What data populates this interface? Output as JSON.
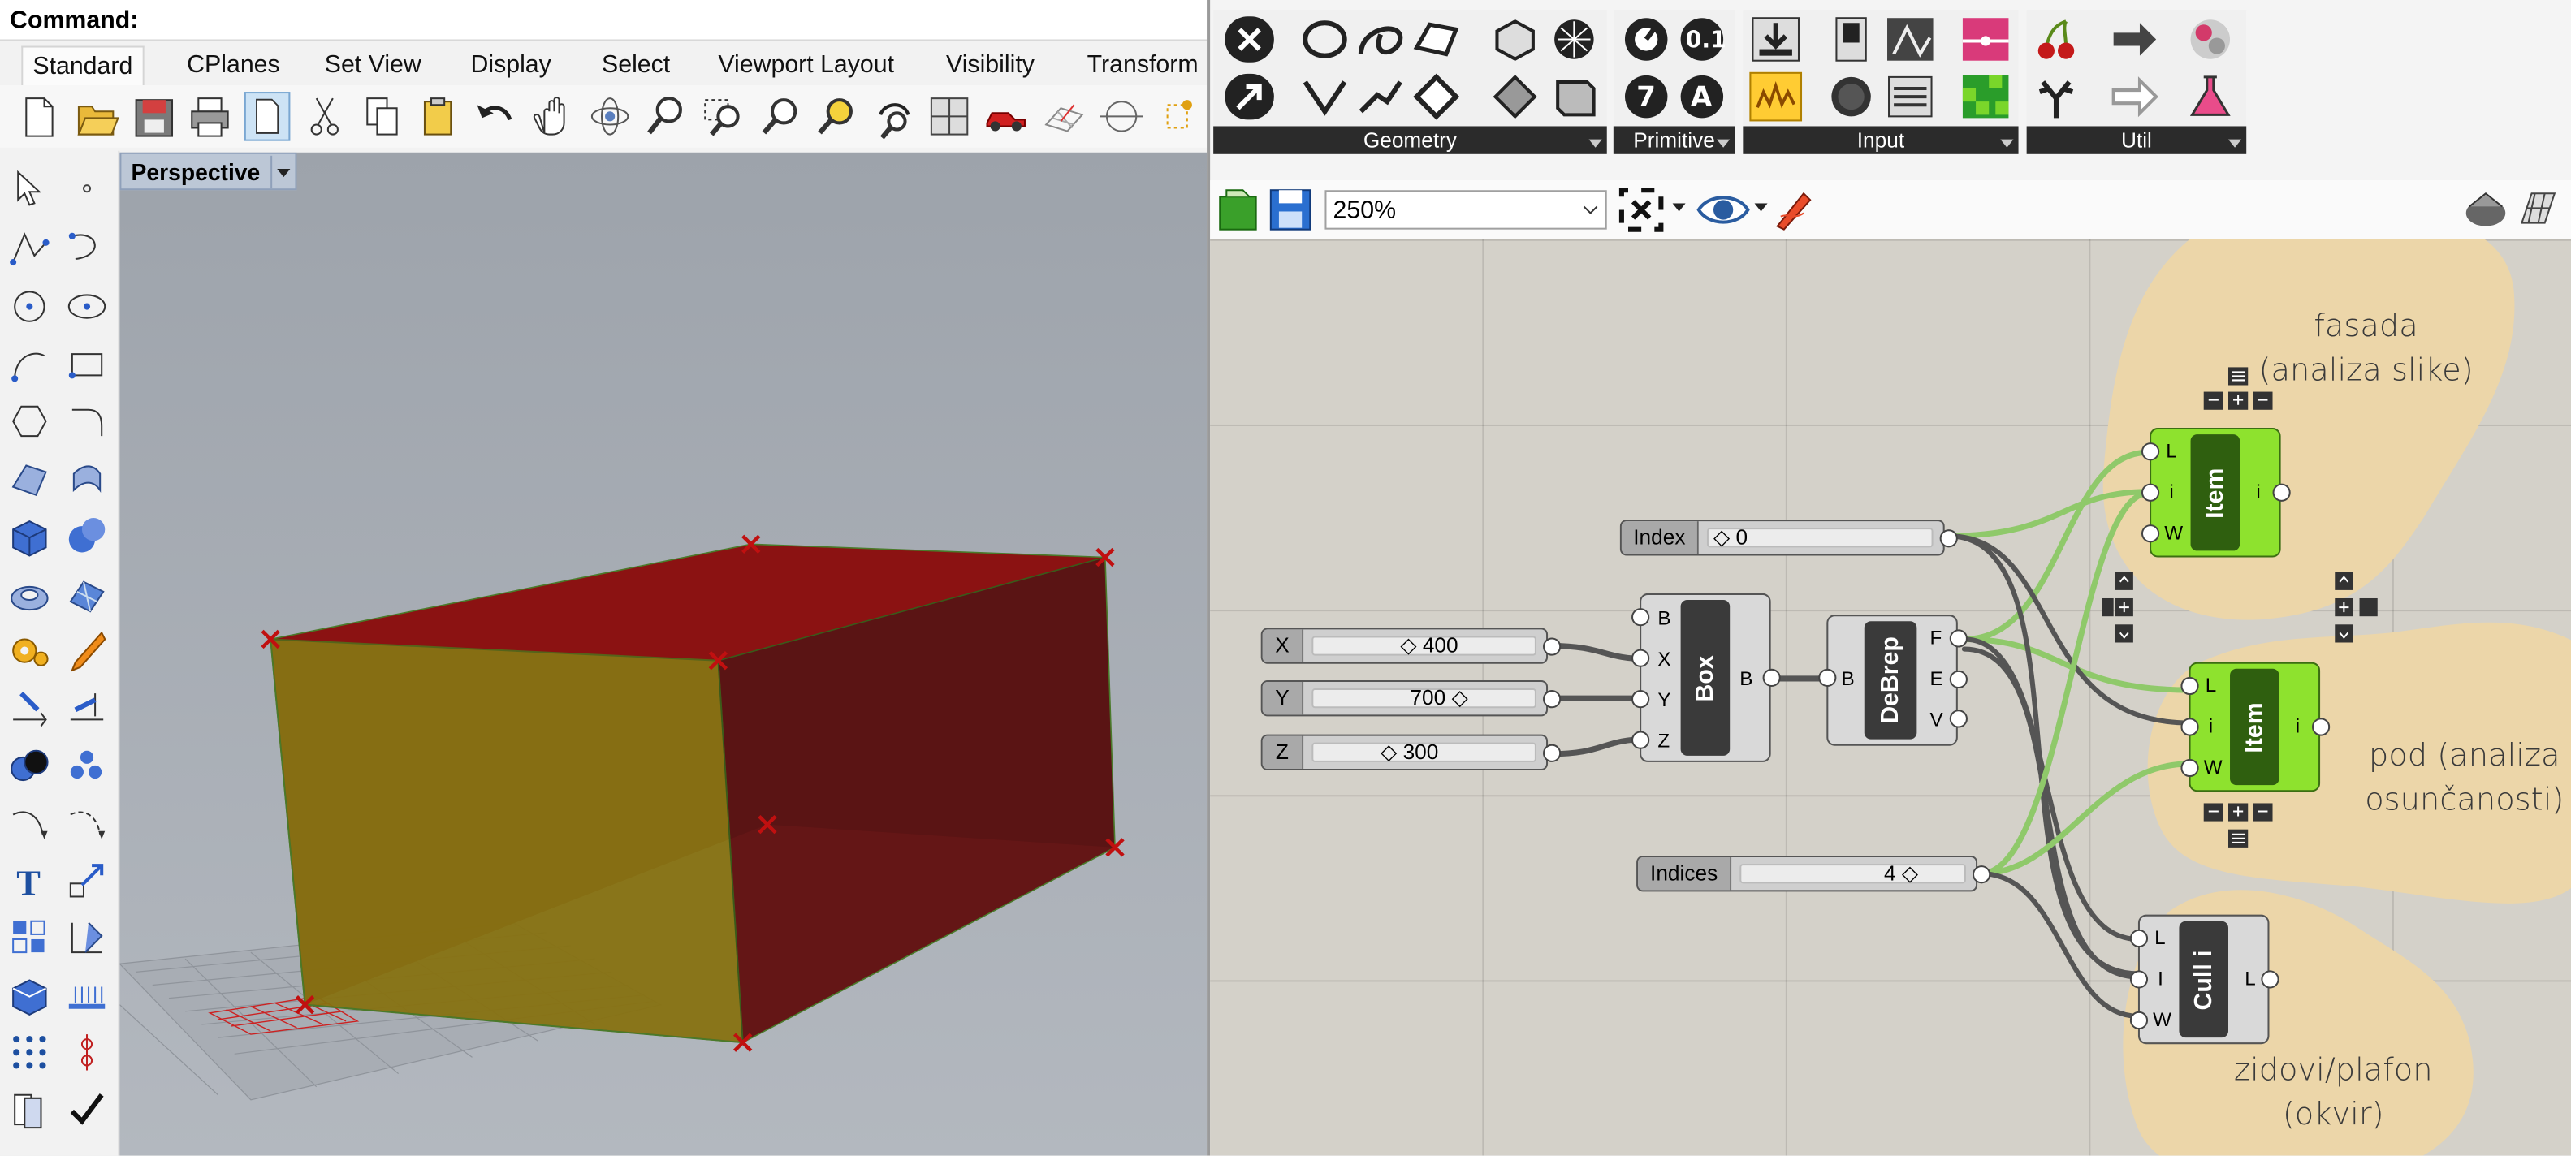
{
  "command": {
    "label": "Command:"
  },
  "rhino_tabs": [
    "Standard",
    "CPlanes",
    "Set View",
    "Display",
    "Select",
    "Viewport Layout",
    "Visibility",
    "Transform"
  ],
  "rhino_toolbar_icons": [
    "new-icon",
    "open-icon",
    "save-icon",
    "print-icon",
    "page-icon",
    "cut-icon",
    "copy-icon",
    "paste-icon",
    "undo-icon",
    "pan-icon",
    "rotate-view-icon",
    "zoom-icon",
    "zoom-window-icon",
    "zoom-extents-icon",
    "zoom-selected-icon",
    "rotate-icon",
    "viewports-icon",
    "car-icon",
    "grid-icon",
    "circle-icon",
    "snap-icon"
  ],
  "viewport": {
    "name": "Perspective"
  },
  "gh_panels": [
    {
      "label": "Geometry"
    },
    {
      "label": "Primitive"
    },
    {
      "label": "Input"
    },
    {
      "label": "Util"
    }
  ],
  "gh_toolbar": {
    "zoom": "250%"
  },
  "gh_nodes": {
    "slider_x": {
      "label": "X",
      "value": "400"
    },
    "slider_y": {
      "label": "Y",
      "value": "700"
    },
    "slider_z": {
      "label": "Z",
      "value": "300"
    },
    "slider_index": {
      "label": "Index",
      "value": "0"
    },
    "slider_indices": {
      "label": "Indices",
      "value": "4"
    },
    "box": {
      "name": "Box",
      "inputs": [
        "B",
        "X",
        "Y",
        "Z"
      ],
      "outputs": [
        "B"
      ]
    },
    "debrep": {
      "name": "DeBrep",
      "inputs": [
        "B"
      ],
      "outputs": [
        "F",
        "E",
        "V"
      ]
    },
    "item1": {
      "name": "Item",
      "inputs": [
        "L",
        "i",
        "W"
      ],
      "outputs": [
        "i"
      ]
    },
    "item2": {
      "name": "Item",
      "inputs": [
        "L",
        "i",
        "W"
      ],
      "outputs": [
        "i"
      ]
    },
    "culli": {
      "name": "Cull i",
      "inputs": [
        "L",
        "I",
        "W"
      ],
      "outputs": [
        "L"
      ]
    }
  },
  "gh_groups": {
    "fasada": {
      "line1": "fasada",
      "line2": "(analiza slike)"
    },
    "pod": {
      "line1": "pod (analiza",
      "line2": "osunčanosti)"
    },
    "zidovi": {
      "line1": "zidovi/plafon",
      "line2": "(okvir)"
    }
  },
  "colors": {
    "box_face": "#8b1010",
    "front_face": "#7a7a14",
    "gh_canvas": "#d4d1c9",
    "group_blob": "#efd7a9",
    "component_green": "#8ee22e"
  }
}
